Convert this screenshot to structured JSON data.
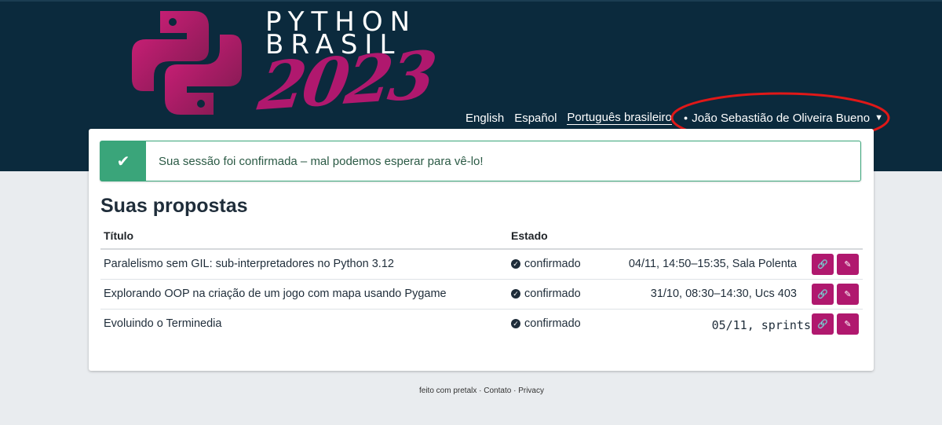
{
  "brand": {
    "word1": "PYTHON",
    "word2": "BRASIL",
    "year": "2023",
    "colors": {
      "header_bg": "#0b2a3d",
      "accent": "#b0186e",
      "success": "#3aa57a"
    }
  },
  "nav": {
    "languages": [
      "English",
      "Español",
      "Português brasileiro"
    ],
    "active_language": "Português brasileiro",
    "user_name": "João Sebastião de Oliveira Bueno",
    "user_dot": "●",
    "caret": "▼"
  },
  "alert": {
    "icon": "check-icon",
    "glyph": "✔",
    "message": "Sua sessão foi confirmada – mal podemos esperar para vê-lo!"
  },
  "proposals": {
    "heading": "Suas propostas",
    "columns": [
      "Título",
      "Estado"
    ],
    "rows": [
      {
        "title": "Paralelismo sem GIL: sub-interpretadores no Python 3.12",
        "state": "confirmado",
        "time": "04/11, 14:50–15:35, Sala Polenta"
      },
      {
        "title": "Explorando OOP na criação de um jogo com mapa usando Pygame",
        "state": "confirmado",
        "time": "31/10, 08:30–14:30, Ucs 403"
      },
      {
        "title": "Evoluindo o Terminedia",
        "state": "confirmado",
        "time": "05/11,  sprints"
      }
    ],
    "icons": {
      "state": "check-circle-icon",
      "link": "link-icon",
      "edit": "edit-icon"
    },
    "glyphs": {
      "check": "✓",
      "link": "🔗",
      "edit": "✎"
    }
  },
  "footer": {
    "made_with": "feito com pretalx",
    "sep": "·",
    "contact": "Contato",
    "privacy": "Privacy"
  }
}
